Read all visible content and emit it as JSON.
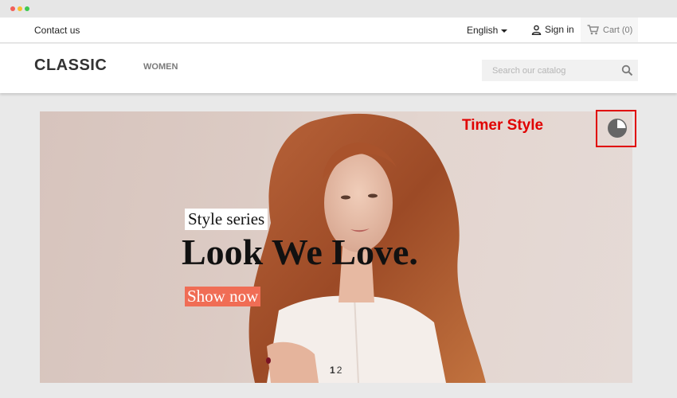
{
  "top_nav": {
    "contact": "Contact us",
    "language": "English",
    "signin": "Sign in",
    "cart": "Cart (0)"
  },
  "header": {
    "logo": "CLASSIC",
    "menu": [
      "WOMEN"
    ],
    "search_placeholder": "Search our catalog"
  },
  "slider": {
    "tag": "Style series",
    "headline": "Look We Love.",
    "cta": "Show now",
    "pages": [
      "1",
      "2"
    ],
    "active_page": "1"
  },
  "annotation": {
    "label": "Timer Style",
    "color": "#e00000",
    "icon": "timer-pie-icon"
  },
  "colors": {
    "cta": "#f06d55",
    "background": "#e9e9e9"
  }
}
